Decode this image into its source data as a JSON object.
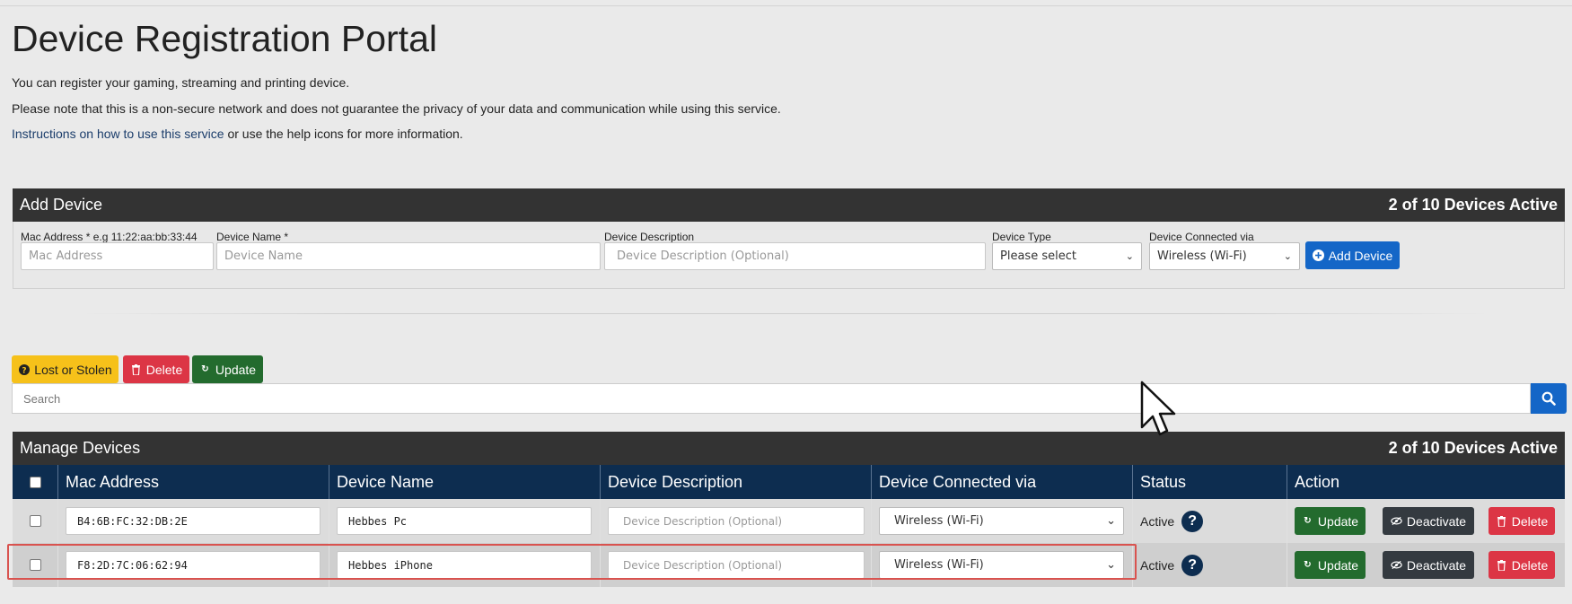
{
  "page": {
    "title": "Device Registration Portal",
    "intro_1": "You can register your gaming, streaming and printing device.",
    "intro_2": "Please note that this is a non-secure network and does not guarantee the privacy of your data and communication while using this service.",
    "intro_3_link": "Instructions on how to use this service",
    "intro_3_rest": " or use the help icons for more information."
  },
  "add_device": {
    "header": "Add Device",
    "active_count": "2 of 10 Devices Active",
    "mac_label": "Mac Address * e.g 11:22:aa:bb:33:44",
    "mac_placeholder": "Mac Address",
    "name_label": "Device Name *",
    "name_placeholder": "Device Name",
    "desc_label": "Device Description",
    "desc_placeholder": "Device Description (Optional)",
    "type_label": "Device Type",
    "type_selected": "Please select",
    "via_label": "Device Connected via",
    "via_selected": "Wireless (Wi-Fi)",
    "add_button": "Add Device"
  },
  "toolbar": {
    "lost_label": "Lost or Stolen",
    "delete_label": "Delete",
    "update_label": "Update"
  },
  "search": {
    "placeholder": "Search"
  },
  "manage": {
    "header": "Manage Devices",
    "active_count": "2 of 10 Devices Active",
    "columns": [
      "Mac Address",
      "Device Name",
      "Device Description",
      "Device Connected via",
      "Status",
      "Action"
    ],
    "rows": [
      {
        "mac": "B4:6B:FC:32:DB:2E",
        "name": "Hebbes Pc",
        "desc_placeholder": "Device Description (Optional)",
        "via": "Wireless (Wi-Fi)",
        "status": "Active",
        "update": "Update",
        "deactivate": "Deactivate",
        "delete": "Delete"
      },
      {
        "mac": "F8:2D:7C:06:62:94",
        "name": "Hebbes iPhone",
        "desc_placeholder": "Device Description (Optional)",
        "via": "Wireless (Wi-Fi)",
        "status": "Active",
        "update": "Update",
        "deactivate": "Deactivate",
        "delete": "Delete"
      }
    ]
  },
  "colors": {
    "header_dark": "#333333",
    "table_head": "#0d2d50",
    "primary": "#1466c7",
    "success": "#236b2e",
    "danger": "#dc3545",
    "warning": "#f6c11a",
    "highlight": "#d9534f"
  },
  "icons": {
    "add": "plus-circle-icon",
    "lost": "question-circle-icon",
    "delete": "trash-icon",
    "update": "refresh-icon",
    "deactivate": "eye-slash-icon",
    "search": "search-icon",
    "help": "help-icon"
  }
}
